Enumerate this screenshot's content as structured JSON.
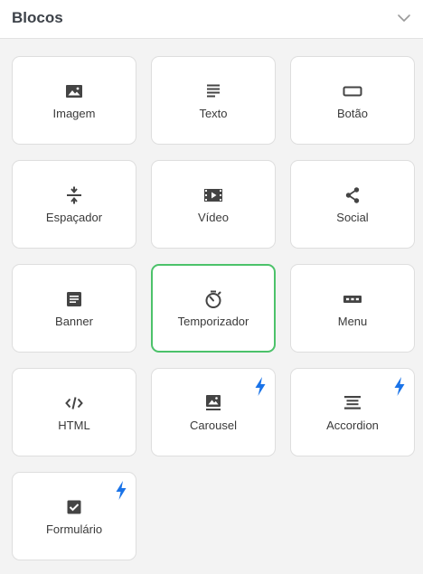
{
  "header": {
    "title": "Blocos"
  },
  "colors": {
    "selected_border": "#4cc26a",
    "bolt": "#1a73e8",
    "icon": "#444444"
  },
  "blocks": [
    {
      "label": "Imagem",
      "icon": "image-icon"
    },
    {
      "label": "Texto",
      "icon": "text-lines-icon"
    },
    {
      "label": "Botão",
      "icon": "button-icon"
    },
    {
      "label": "Espaçador",
      "icon": "spacer-icon"
    },
    {
      "label": "Vídeo",
      "icon": "video-icon"
    },
    {
      "label": "Social",
      "icon": "share-icon"
    },
    {
      "label": "Banner",
      "icon": "banner-icon"
    },
    {
      "label": "Temporizador",
      "icon": "timer-icon",
      "selected": true
    },
    {
      "label": "Menu",
      "icon": "menu-icon"
    },
    {
      "label": "HTML",
      "icon": "code-icon"
    },
    {
      "label": "Carousel",
      "icon": "carousel-icon",
      "premium": true
    },
    {
      "label": "Accordion",
      "icon": "accordion-icon",
      "premium": true
    },
    {
      "label": "Formulário",
      "icon": "checkbox-icon",
      "premium": true
    }
  ]
}
